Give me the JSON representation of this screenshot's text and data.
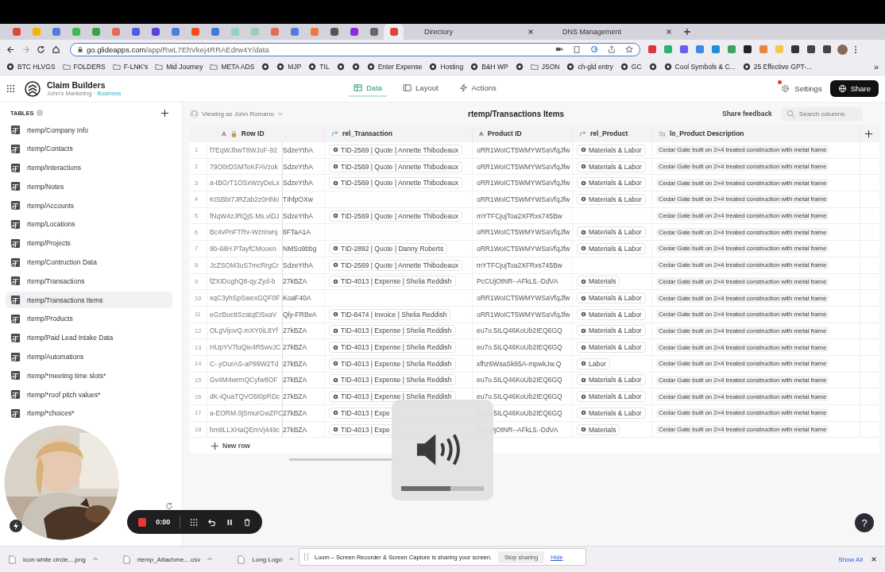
{
  "browser": {
    "pinned_tabs": [
      {
        "color": "#e0453c",
        "selected": false
      },
      {
        "color": "#f4b400",
        "selected": false
      },
      {
        "color": "#4a7fe0",
        "selected": false
      },
      {
        "color": "#3fb950",
        "selected": false
      },
      {
        "color": "#38a24a",
        "selected": false
      },
      {
        "color": "#e8695a",
        "selected": false
      },
      {
        "color": "#4d5de8",
        "selected": false
      },
      {
        "color": "#5a3fd8",
        "selected": false
      },
      {
        "color": "#4a7fe0",
        "selected": false
      },
      {
        "color": "#f04e1a",
        "selected": false
      },
      {
        "color": "#3d7bd8",
        "selected": false
      },
      {
        "color": "#8fd4c6",
        "selected": false
      },
      {
        "color": "#9ccfb0",
        "selected": false
      },
      {
        "color": "#e8695a",
        "selected": false
      },
      {
        "color": "#4a7fe0",
        "selected": false
      },
      {
        "color": "#ef7a3c",
        "selected": false
      },
      {
        "color": "#555555",
        "selected": false
      },
      {
        "color": "#8a2be2",
        "selected": false
      },
      {
        "color": "#666666",
        "selected": false
      },
      {
        "color": "#e0453c",
        "selected": true
      }
    ],
    "tabs": [
      {
        "title": "Directory"
      },
      {
        "title": "DNS Management"
      }
    ],
    "url_host": "go.glideapps.com",
    "url_path": "/app/RwL7EhVkej4RRAEdrw4Y/data",
    "bookmarks": [
      {
        "kind": "site",
        "label": "BTC HLVGS"
      },
      {
        "kind": "folder",
        "label": "FOLDERS"
      },
      {
        "kind": "folder",
        "label": "F-LNK's"
      },
      {
        "kind": "folder",
        "label": "Mid Journey"
      },
      {
        "kind": "folder",
        "label": "META ADS"
      },
      {
        "kind": "site"
      },
      {
        "kind": "site",
        "label": "MJP"
      },
      {
        "kind": "site",
        "label": "TIL"
      },
      {
        "kind": "site"
      },
      {
        "kind": "site"
      },
      {
        "kind": "site",
        "label": "Enter Expense"
      },
      {
        "kind": "site",
        "label": "Hosting"
      },
      {
        "kind": "site",
        "label": "B&H WP"
      },
      {
        "kind": "site"
      },
      {
        "kind": "folder",
        "label": "JSON"
      },
      {
        "kind": "site",
        "label": "ch-gld entry"
      },
      {
        "kind": "site",
        "label": "GC"
      },
      {
        "kind": "site"
      },
      {
        "kind": "site",
        "label": "Cool Symbols & C..."
      },
      {
        "kind": "site",
        "label": "25 Effective GPT-..."
      }
    ],
    "more_bookmarks": "»"
  },
  "app": {
    "name": "Claim Builders",
    "team": "John's Marketing",
    "team_separator": "·",
    "plan": "Business",
    "nav": [
      {
        "label": "Data",
        "kind": "data",
        "selected": true
      },
      {
        "label": "Layout",
        "kind": "layout",
        "selected": false
      },
      {
        "label": "Actions",
        "kind": "actions",
        "selected": false
      }
    ],
    "settings": "Settings",
    "settings_notification": true,
    "share": "Share"
  },
  "sidebar": {
    "heading": "TABLES",
    "items": [
      {
        "label": "rtemp/Company Info",
        "selected": false
      },
      {
        "label": "rtemp/Contacts",
        "selected": false
      },
      {
        "label": "rtemp/Interactions",
        "selected": false
      },
      {
        "label": "rtemp/Notes",
        "selected": false
      },
      {
        "label": "rtemp/Accounts",
        "selected": false
      },
      {
        "label": "rtemp/Locations",
        "selected": false
      },
      {
        "label": "rtemp/Projects",
        "selected": false
      },
      {
        "label": "rtemp/Contruction Data",
        "selected": false
      },
      {
        "label": "rtemp/Transactions",
        "selected": false
      },
      {
        "label": "rtemp/Transactions Items",
        "selected": true
      },
      {
        "label": "rtemp/Products",
        "selected": false
      },
      {
        "label": "rtemp/Paid Lead Intake Data",
        "selected": false
      },
      {
        "label": "rtemp/Automations",
        "selected": false
      },
      {
        "label": "rtemp/*meeting time slots*",
        "selected": false
      },
      {
        "label": "rtemp/*roof pitch values*",
        "selected": false
      },
      {
        "label": "rtemp/*choices*",
        "selected": false
      }
    ]
  },
  "table": {
    "viewing_as": "Viewing as John Romano",
    "title": "rtemp/Transactions Items",
    "share_feedback": "Share feedback",
    "search": {
      "placeholder": "Search columns"
    },
    "columns": [
      {
        "name": "Row ID",
        "kind": "text",
        "glyph": "A",
        "locked": true
      },
      {
        "name": "rel_Transaction",
        "kind": "relation"
      },
      {
        "name": "Product ID",
        "kind": "text",
        "glyph": "A",
        "locked": false
      },
      {
        "name": "rel_Product",
        "kind": "relation"
      },
      {
        "name": "lo_Product Description",
        "kind": "lookup"
      }
    ],
    "rows": [
      {
        "num": "1",
        "row_id": "f7EqWJbwT8WJoF-92",
        "column_2": "SdzeYthA",
        "transaction": "TID-2569 | Quote | Annette Thibodeaux",
        "product_id": "oRR1WoICT5WMYWSaVfqJfw",
        "product": "Materials & Labor",
        "description": "Cedar Gate built on 2×4 treated construction with metal frame"
      },
      {
        "num": "2",
        "row_id": "79O0rDSMTeKFAVzok",
        "column_2": "SdzeYthA",
        "transaction": "TID-2569 | Quote | Annette Thibodeaux",
        "product_id": "oRR1WoICT5WMYWSaVfqJfw",
        "product": "Materials & Labor",
        "description": "Cedar Gate built on 2×4 treated construction with metal frame"
      },
      {
        "num": "3",
        "row_id": "a-tBGrT1OSxWzyDeLx",
        "column_2": "SdzeYthA",
        "transaction": "TID-2569 | Quote | Annette Thibodeaux",
        "product_id": "oRR1WoICT5WMYWSaVfqJfw",
        "product": "Materials & Labor",
        "description": "Cedar Gate built on 2×4 treated construction with metal frame"
      },
      {
        "num": "4",
        "row_id": "KtSBbt7JRZab2z0HhkI",
        "column_2": "TIhfpOXw",
        "product_id": "oRR1WoICT5WMYWSaVfqJfw",
        "product": "Materials & Labor",
        "description": "Cedar Gate built on 2×4 treated construction with metal frame"
      },
      {
        "num": "5",
        "row_id": "fNqW4zJRQjS.Ms.viDJ",
        "column_2": "SdzeYthA",
        "transaction": "TID-2569 | Quote | Annette Thibodeaux",
        "product_id": "mYTFCjujToa2XFRxs745Bw",
        "description": "Cedar Gate built on 2×4 treated construction with metal frame"
      },
      {
        "num": "6",
        "row_id": "Bc4vPnFTRv-Wzrirwnj",
        "column_2": "6FTaA1A",
        "product_id": "oRR1WoICT5WMYWSaVfqJfw",
        "product": "Materials & Labor",
        "description": "Cedar Gate built on 2×4 treated construction with metal frame"
      },
      {
        "num": "7",
        "row_id": "9b-68H.PTayfCMooen",
        "column_2": "NMSo9bbg",
        "transaction": "TID-2892 | Quote | Danny Roberts",
        "product_id": "oRR1WoICT5WMYWSaVfqJfw",
        "product": "Materials & Labor",
        "description": "Cedar Gate built on 2×4 treated construction with metal frame"
      },
      {
        "num": "8",
        "row_id": "JcZSOM3uS7mcRrgCr",
        "column_2": "SdzeYthA",
        "transaction": "TID-2569 | Quote | Annette Thibodeaux",
        "product_id": "mYTFCjujToa2XFRxs745Bw",
        "description": "Cedar Gate built on 2×4 treated construction with metal frame"
      },
      {
        "num": "9",
        "row_id": "fZXIDoghQ8-qy.Zyd-b",
        "column_2": "27kBZA",
        "transaction": "TID-4013 | Expense | Shelia Reddish",
        "product_id": "PcCUjOtNR--AFkL5.-DdVA",
        "product": "Materials",
        "description": "Cedar Gate built on 2×4 treated construction with metal frame"
      },
      {
        "num": "10",
        "row_id": "xqC3yhSpSwexGQF0F",
        "column_2": "KoaF40A",
        "product_id": "oRR1WoICT5WMYWSaVfqJfw",
        "product": "Materials & Labor",
        "description": "Cedar Gate built on 2×4 treated construction with metal frame"
      },
      {
        "num": "11",
        "row_id": "eGzBucttSzatqEI5xaV",
        "column_2": "Qly-FRBvA",
        "transaction": "TID-8474 | Invoice | Shelia Reddish",
        "product_id": "oRR1WoICT5WMYWSaVfqJfw",
        "product": "Materials & Labor",
        "description": "Cedar Gate built on 2×4 treated construction with metal frame"
      },
      {
        "num": "12",
        "row_id": "OLgVijovQ.mXY0iL8Yf",
        "column_2": "27kBZA",
        "transaction": "TID-4013 | Expense | Shelia Reddish",
        "product_id": "eu7o.5ILQ46KoUb2IEQ6GQ",
        "product": "Materials & Labor",
        "description": "Cedar Gate built on 2×4 treated construction with metal frame"
      },
      {
        "num": "13",
        "row_id": "HUpYV7luQie4R5wvJC",
        "column_2": "27kBZA",
        "transaction": "TID-4013 | Expense | Shelia Reddish",
        "product_id": "eu7o.5ILQ46KoUb2IEQ6GQ",
        "product": "Materials & Labor",
        "description": "Cedar Gate built on 2×4 treated construction with metal frame"
      },
      {
        "num": "14",
        "row_id": "C-.yOurAS-aP99W2Td",
        "column_2": "27kBZA",
        "transaction": "TID-4013 | Expense | Shelia Reddish",
        "product_id": "xfhz6WsaSk65A-mpwkJw.Q",
        "product": "Labor",
        "description": "Cedar Gate built on 2×4 treated construction with metal frame"
      },
      {
        "num": "15",
        "row_id": "Gv4M4wrmQCyfw8OF",
        "column_2": "27kBZA",
        "transaction": "TID-4013 | Expense | Shelia Reddish",
        "product_id": "eu7o.5ILQ46KoUb2IEQ6GQ",
        "product": "Materials & Labor",
        "description": "Cedar Gate built on 2×4 treated construction with metal frame"
      },
      {
        "num": "16",
        "row_id": "dK-iQuaTQVO5t0pRDc",
        "column_2": "27kBZA",
        "transaction": "TID-4013 | Expense | Shelia Reddish",
        "product_id": "eu7o.5ILQ46KoUb2IEQ6GQ",
        "product": "Materials & Labor",
        "description": "Cedar Gate built on 2×4 treated construction with metal frame"
      },
      {
        "num": "17",
        "row_id": "a-EORM.0jSmurGwZPC",
        "column_2": "27kBZA",
        "transaction": "TID-4013 | Expe",
        "product_id": "eu7o.5ILQ46KoUb2IEQ6GQ",
        "product": "Materials & Labor",
        "description": "Cedar Gate built on 2×4 treated construction with metal frame"
      },
      {
        "num": "18",
        "row_id": "hm8LLXHaQEmVj449c",
        "column_2": "27kBZA",
        "transaction": "TID-4013 | Expe",
        "product_id": "PcCUjOtNR--AFkL5.-DdVA",
        "product": "Materials",
        "description": "Cedar Gate built on 2×4 treated construction with metal frame"
      }
    ],
    "new_row": "New row"
  },
  "recorder": {
    "time": "0:00"
  },
  "volume_hud": {
    "level": 0.6
  },
  "downloads": {
    "items": [
      {
        "name": "icon white circle....png"
      },
      {
        "name": "rtemp_Attachme....csv"
      },
      {
        "name": "Long Logo"
      }
    ],
    "show_all": "Show All"
  },
  "loom_bar": {
    "message": "Loom – Screen Recorder & Screen Capture is sharing your screen.",
    "stop": "Stop sharing",
    "hide": "Hide"
  },
  "help": "?"
}
